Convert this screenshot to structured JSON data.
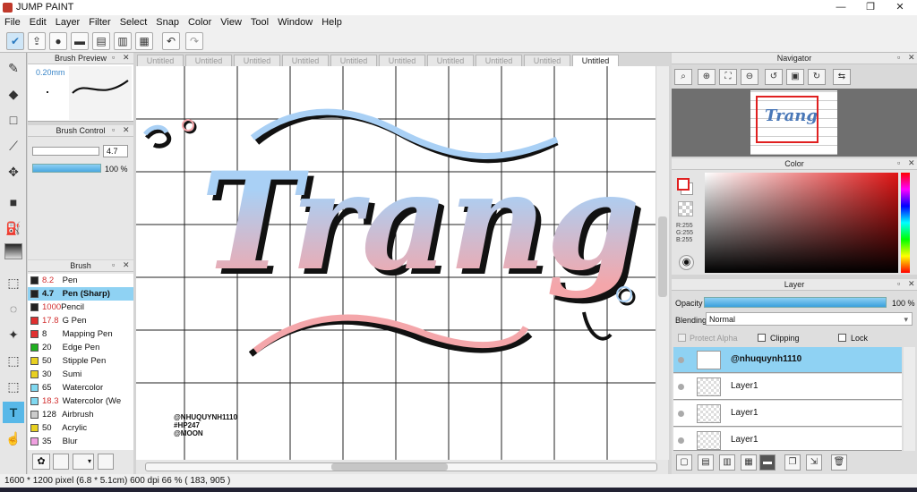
{
  "app": {
    "title": "JUMP PAINT"
  },
  "window_controls": {
    "minimize": "—",
    "maximize": "❐",
    "close": "✕"
  },
  "menu": [
    "File",
    "Edit",
    "Layer",
    "Filter",
    "Select",
    "Snap",
    "Color",
    "View",
    "Tool",
    "Window",
    "Help"
  ],
  "brush_preview": {
    "title": "Brush Preview",
    "size_label": "0.20mm"
  },
  "brush_control": {
    "title": "Brush Control",
    "size_value": "4.7",
    "opacity_value": "100 %"
  },
  "brush_panel": {
    "title": "Brush",
    "items": [
      {
        "size": "8.2",
        "name": "Pen",
        "color": "#222222",
        "size_red": true
      },
      {
        "size": "4.7",
        "name": "Pen (Sharp)",
        "color": "#222222",
        "size_red": false,
        "selected": true
      },
      {
        "size": "1000",
        "name": "Pencil",
        "color": "#222222",
        "size_red": true
      },
      {
        "size": "17.8",
        "name": "G Pen",
        "color": "#e03030",
        "size_red": true
      },
      {
        "size": "8",
        "name": "Mapping Pen",
        "color": "#e03030",
        "size_red": false
      },
      {
        "size": "20",
        "name": "Edge Pen",
        "color": "#20b020",
        "size_red": false
      },
      {
        "size": "50",
        "name": "Stipple Pen",
        "color": "#e8d020",
        "size_red": false
      },
      {
        "size": "30",
        "name": "Sumi",
        "color": "#e8d020",
        "size_red": false
      },
      {
        "size": "65",
        "name": "Watercolor",
        "color": "#7fd8f0",
        "size_red": false
      },
      {
        "size": "18.3",
        "name": "Watercolor (We",
        "color": "#7fd8f0",
        "size_red": true
      },
      {
        "size": "128",
        "name": "Airbrush",
        "color": "#cccccc",
        "size_red": false
      },
      {
        "size": "50",
        "name": "Acrylic",
        "color": "#e8d020",
        "size_red": false
      },
      {
        "size": "35",
        "name": "Blur",
        "color": "#f0a0e0",
        "size_red": false
      }
    ]
  },
  "tabs": [
    "Untitled",
    "Untitled",
    "Untitled",
    "Untitled",
    "Untitled",
    "Untitled",
    "Untitled",
    "Untitled",
    "Untitled",
    "Untitled"
  ],
  "canvas": {
    "lettering": "Trang",
    "credits": [
      "@NHUQUYNH1110",
      "#HP247",
      "@MOON"
    ],
    "colors": {
      "blue": "#a9d0f5",
      "pink": "#f4a6aa",
      "ink": "#111111"
    }
  },
  "navigator": {
    "title": "Navigator"
  },
  "color_panel": {
    "title": "Color",
    "r": "R:255",
    "g": "G:255",
    "b": "B:255"
  },
  "layer_panel": {
    "title": "Layer",
    "opacity_label": "Opacity",
    "opacity_value": "100 %",
    "blending_label": "Blending",
    "blending_value": "Normal",
    "protect_alpha": "Protect Alpha",
    "clipping": "Clipping",
    "lock": "Lock",
    "layers": [
      {
        "name": "@nhuquynh1110",
        "selected": true
      },
      {
        "name": "Layer1",
        "selected": false
      },
      {
        "name": "Layer1",
        "selected": false
      },
      {
        "name": "Layer1",
        "selected": false
      }
    ]
  },
  "status": {
    "text": "1600 * 1200 pixel   (6.8 * 5.1cm)   600 dpi   66 %   ( 183, 905 )"
  }
}
